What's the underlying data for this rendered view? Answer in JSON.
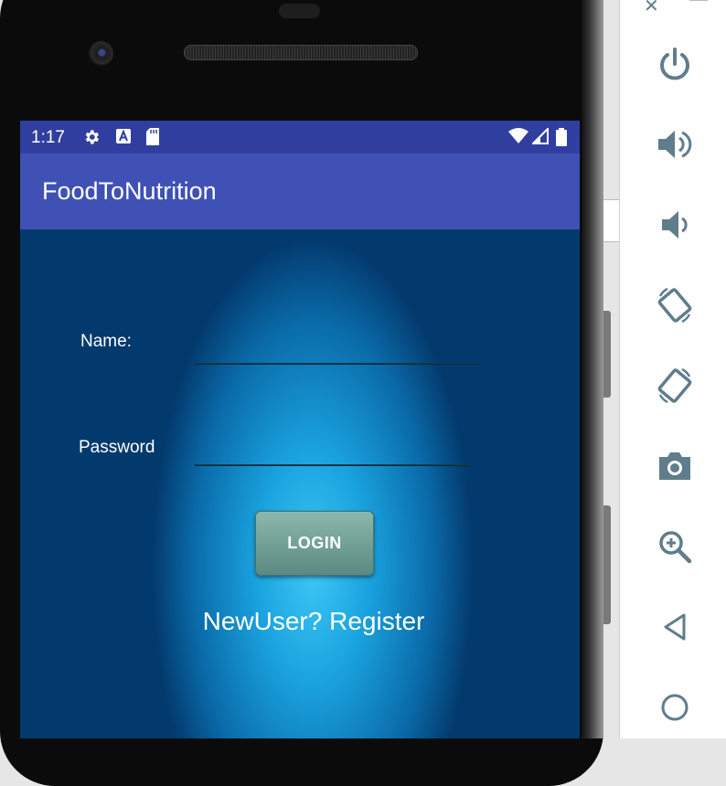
{
  "status_bar": {
    "time": "1:17"
  },
  "app_bar": {
    "title": "FoodToNutrition"
  },
  "form": {
    "name_label": "Name:",
    "name_value": "",
    "password_label": "Password",
    "password_value": "",
    "login_label": "LOGIN",
    "register_link": "NewUser? Register"
  },
  "emulator_panel": {
    "top_controls": [
      "close-icon",
      "minimize-icon"
    ],
    "buttons": [
      "power-icon",
      "volume-up-icon",
      "volume-down-icon",
      "rotate-left-icon",
      "rotate-right-icon",
      "camera-icon",
      "zoom-icon",
      "back-icon",
      "home-icon"
    ]
  },
  "colors": {
    "status_bar": "#303f9f",
    "app_bar": "#3f51b5",
    "login_button": "#6b978f",
    "panel_icon": "#607d8b"
  }
}
